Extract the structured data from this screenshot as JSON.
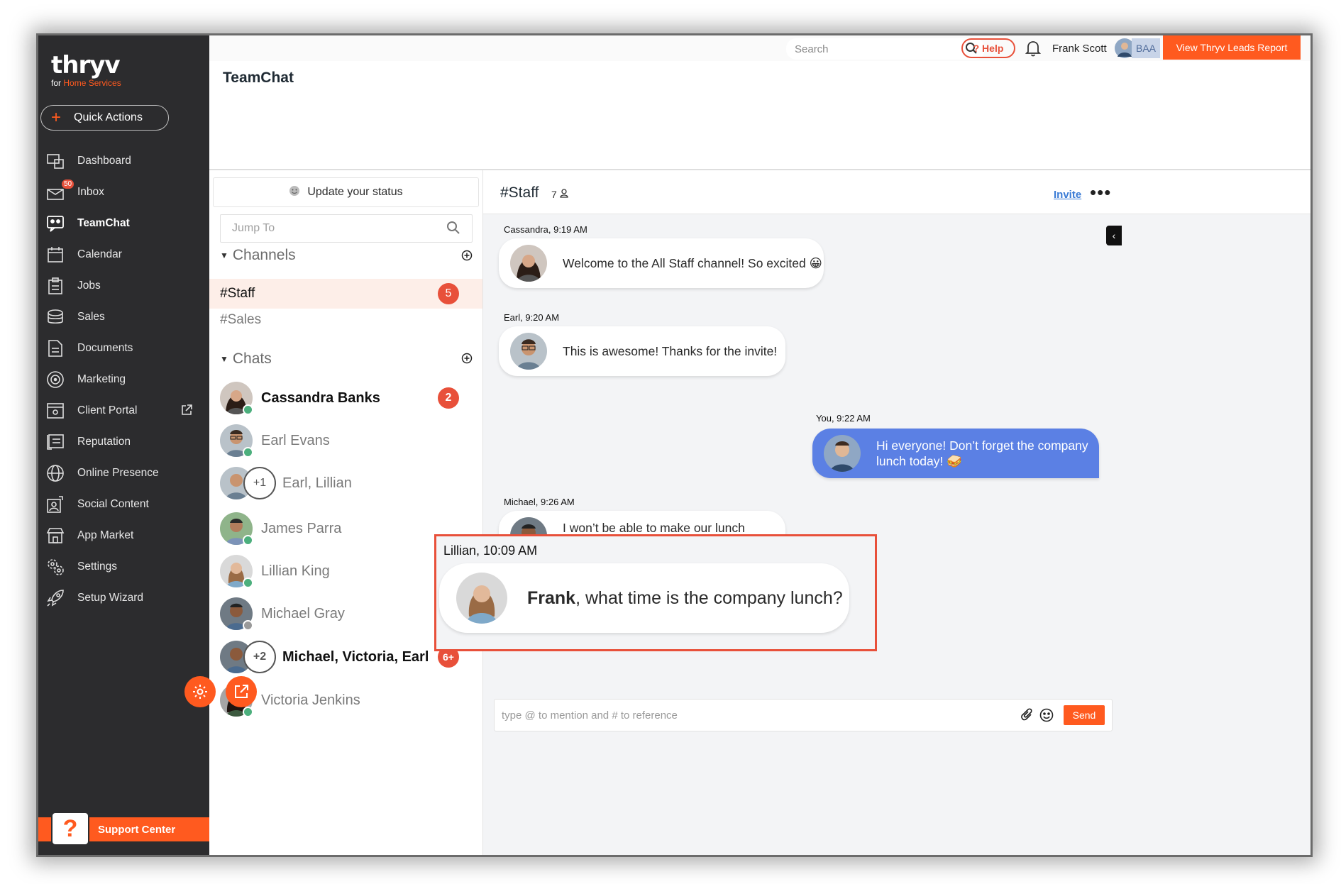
{
  "brand": {
    "logo": "thryv",
    "tagline_prefix": "for",
    "tagline_accent": "Home Services",
    "accent_color": "#ff5a1f"
  },
  "sidebar": {
    "quick_actions": "Quick Actions",
    "items": [
      {
        "label": "Dashboard",
        "icon": "dashboard-icon"
      },
      {
        "label": "Inbox",
        "icon": "inbox-icon",
        "badge": "50"
      },
      {
        "label": "TeamChat",
        "icon": "teamchat-icon",
        "active": true
      },
      {
        "label": "Calendar",
        "icon": "calendar-icon"
      },
      {
        "label": "Jobs",
        "icon": "jobs-icon"
      },
      {
        "label": "Sales",
        "icon": "sales-icon"
      },
      {
        "label": "Documents",
        "icon": "documents-icon"
      },
      {
        "label": "Marketing",
        "icon": "marketing-icon"
      },
      {
        "label": "Client Portal",
        "icon": "client-portal-icon"
      },
      {
        "label": "Reputation",
        "icon": "reputation-icon"
      },
      {
        "label": "Online Presence",
        "icon": "globe-icon"
      },
      {
        "label": "Social Content",
        "icon": "social-content-icon"
      },
      {
        "label": "App Market",
        "icon": "app-market-icon"
      },
      {
        "label": "Settings",
        "icon": "settings-icon"
      },
      {
        "label": "Setup Wizard",
        "icon": "rocket-icon"
      }
    ],
    "support": "Support Center"
  },
  "topbar": {
    "search_placeholder": "Search",
    "help": "? Help",
    "user_name": "Frank Scott",
    "initials": "BAA",
    "leads_button": "View Thryv Leads Report"
  },
  "page_title": "TeamChat",
  "panel": {
    "status": "Update your status",
    "jump_placeholder": "Jump To",
    "channels_header": "Channels",
    "channels": [
      {
        "name": "#Staff",
        "badge": "5",
        "selected": true
      },
      {
        "name": "#Sales",
        "badge": ""
      }
    ],
    "chats_header": "Chats",
    "chats": [
      {
        "name": "Cassandra Banks",
        "badge": "2",
        "bold": true,
        "status": "online"
      },
      {
        "name": "Earl Evans",
        "badge": "",
        "bold": false,
        "status": "online"
      },
      {
        "name": "Earl, Lillian",
        "badge": "",
        "bold": false,
        "extra": "+1"
      },
      {
        "name": "James Parra",
        "badge": "",
        "bold": false,
        "status": "online"
      },
      {
        "name": "Lillian King",
        "badge": "",
        "bold": false,
        "status": "online"
      },
      {
        "name": "Michael Gray",
        "badge": "",
        "bold": false,
        "status": "offline"
      },
      {
        "name": "Michael, Victoria, Earl",
        "badge": "6+",
        "bold": true,
        "extra": "+2"
      },
      {
        "name": "Victoria Jenkins",
        "badge": "",
        "bold": false,
        "status": "online"
      }
    ]
  },
  "channel": {
    "name": "#Staff",
    "member_count": "7",
    "invite": "Invite",
    "messages": [
      {
        "meta": "Cassandra, 9:19 AM",
        "text": "Welcome to the All Staff channel! So excited 😀"
      },
      {
        "meta": "Earl, 9:20 AM",
        "text": "This is awesome! Thanks for the invite!"
      },
      {
        "meta": "You, 9:22 AM",
        "text": "Hi everyone! Don’t forget the company lunch today! 🥪"
      },
      {
        "meta": "Michael, 9:26 AM",
        "text": "I won’t be able to make our lunch today, I have a meeting with a client."
      }
    ],
    "highlight": {
      "meta": "Lillian, 10:09 AM",
      "mention": "Frank",
      "text": ", what time is the company lunch?"
    },
    "composer_placeholder": "type @ to mention and # to reference",
    "send": "Send"
  }
}
